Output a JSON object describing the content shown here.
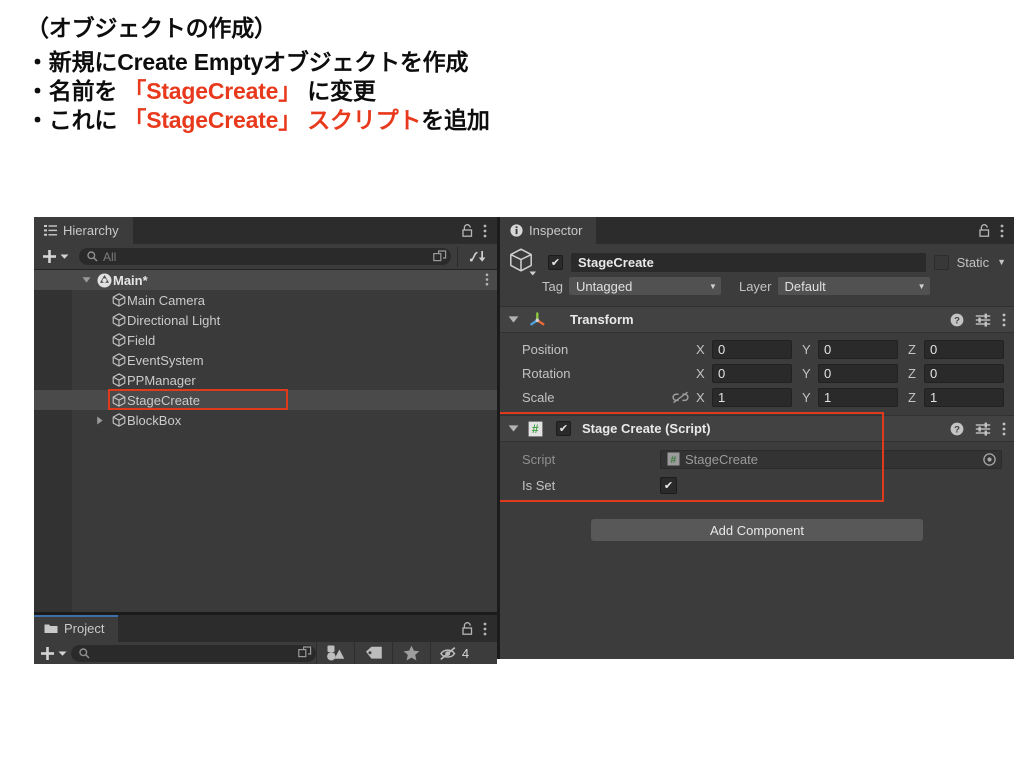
{
  "instructions": {
    "lines": [
      {
        "segments": [
          {
            "text": "（オブジェクトの作成）",
            "accent": false
          }
        ]
      },
      {
        "segments": [
          {
            "text": "・新規にCreate Emptyオブジェクトを作成",
            "accent": false
          }
        ]
      },
      {
        "segments": [
          {
            "text": "・名前を ",
            "accent": false
          },
          {
            "text": "「StageCreate」",
            "accent": true
          },
          {
            "text": " に変更",
            "accent": false
          }
        ]
      },
      {
        "segments": [
          {
            "text": "・これに ",
            "accent": false
          },
          {
            "text": "「StageCreate」 スクリプト",
            "accent": true
          },
          {
            "text": "を追加",
            "accent": false
          }
        ]
      }
    ],
    "accent_color": "#e8391c"
  },
  "hierarchy": {
    "tab_label": "Hierarchy",
    "tab_icon": "list-icon",
    "lock_icon": "lock-icon",
    "menu_icon": "kebab-menu-icon",
    "add_button_label": "+",
    "search": {
      "placeholder": "All",
      "value": "",
      "icon": "search-icon",
      "expand_icon": "expand-icon"
    },
    "sort_icon": "sort-icon",
    "items": [
      {
        "label": "Main*",
        "depth": 0,
        "expanded": true,
        "has_children": true,
        "selected": false,
        "is_root": true,
        "icon": "unity-scene-icon"
      },
      {
        "label": "Main Camera",
        "depth": 1,
        "expanded": false,
        "has_children": false,
        "selected": false,
        "is_root": false,
        "icon": "gameobject-cube-icon"
      },
      {
        "label": "Directional Light",
        "depth": 1,
        "expanded": false,
        "has_children": false,
        "selected": false,
        "is_root": false,
        "icon": "gameobject-cube-icon"
      },
      {
        "label": "Field",
        "depth": 1,
        "expanded": false,
        "has_children": false,
        "selected": false,
        "is_root": false,
        "icon": "gameobject-cube-icon"
      },
      {
        "label": "EventSystem",
        "depth": 1,
        "expanded": false,
        "has_children": false,
        "selected": false,
        "is_root": false,
        "icon": "gameobject-cube-icon"
      },
      {
        "label": "PPManager",
        "depth": 1,
        "expanded": false,
        "has_children": false,
        "selected": false,
        "is_root": false,
        "icon": "gameobject-cube-icon"
      },
      {
        "label": "StageCreate",
        "depth": 1,
        "expanded": false,
        "has_children": false,
        "selected": true,
        "is_root": false,
        "icon": "gameobject-cube-icon",
        "highlighted": true
      },
      {
        "label": "BlockBox",
        "depth": 1,
        "expanded": false,
        "has_children": true,
        "selected": false,
        "is_root": false,
        "icon": "gameobject-cube-icon"
      }
    ]
  },
  "project": {
    "tab_label": "Project",
    "tab_icon": "folder-icon",
    "lock_icon": "lock-icon",
    "menu_icon": "kebab-menu-icon",
    "add_button_label": "+",
    "search": {
      "placeholder": "",
      "value": "",
      "icon": "search-icon",
      "expand_icon": "expand-icon"
    },
    "filter_icons": [
      "shapes-filter-icon",
      "label-filter-icon",
      "star-filter-icon",
      "hidden-filter-icon"
    ],
    "hidden_count": "4"
  },
  "inspector": {
    "tab_label": "Inspector",
    "tab_icon": "info-icon",
    "lock_icon": "lock-icon",
    "menu_icon": "kebab-menu-icon",
    "object": {
      "icon": "gameobject-cube-icon",
      "enabled": true,
      "name": "StageCreate",
      "static_checked": false,
      "static_label": "Static",
      "static_dropdown_icon": "chevron-down-icon",
      "tag_label": "Tag",
      "tag_value": "Untagged",
      "layer_label": "Layer",
      "layer_value": "Default"
    },
    "components": [
      {
        "title": "Transform",
        "icon": "transform-gizmo-icon",
        "expanded": true,
        "help_icon": "help-icon",
        "settings_icon": "settings-icon",
        "menu_icon": "kebab-menu-icon",
        "rows": [
          {
            "label": "Position",
            "link": false,
            "axes": [
              {
                "axis": "X",
                "value": "0"
              },
              {
                "axis": "Y",
                "value": "0"
              },
              {
                "axis": "Z",
                "value": "0"
              }
            ]
          },
          {
            "label": "Rotation",
            "link": false,
            "axes": [
              {
                "axis": "X",
                "value": "0"
              },
              {
                "axis": "Y",
                "value": "0"
              },
              {
                "axis": "Z",
                "value": "0"
              }
            ]
          },
          {
            "label": "Scale",
            "link": true,
            "link_icon": "link-broken-icon",
            "axes": [
              {
                "axis": "X",
                "value": "1"
              },
              {
                "axis": "Y",
                "value": "1"
              },
              {
                "axis": "Z",
                "value": "1"
              }
            ]
          }
        ]
      }
    ],
    "script_component": {
      "title": "Stage Create (Script)",
      "icon": "cs-script-icon",
      "enabled": true,
      "expanded": true,
      "help_icon": "help-icon",
      "settings_icon": "settings-icon",
      "menu_icon": "kebab-menu-icon",
      "highlighted": true,
      "script_field": {
        "label": "Script",
        "value": "StageCreate",
        "icon": "cs-script-icon",
        "picker_icon": "object-picker-icon"
      },
      "is_set_field": {
        "label": "Is Set",
        "checked": true
      }
    },
    "add_component_label": "Add Component"
  },
  "colors": {
    "panel_bg": "#3c3c3c",
    "hierarchy_bg": "#3a3a3a",
    "component_header": "#424242",
    "highlight_red": "#e03a1c",
    "selected_row": "#4a4a4a",
    "tab_active": "#3c3c3c",
    "field_bg": "#2a2a2a"
  }
}
